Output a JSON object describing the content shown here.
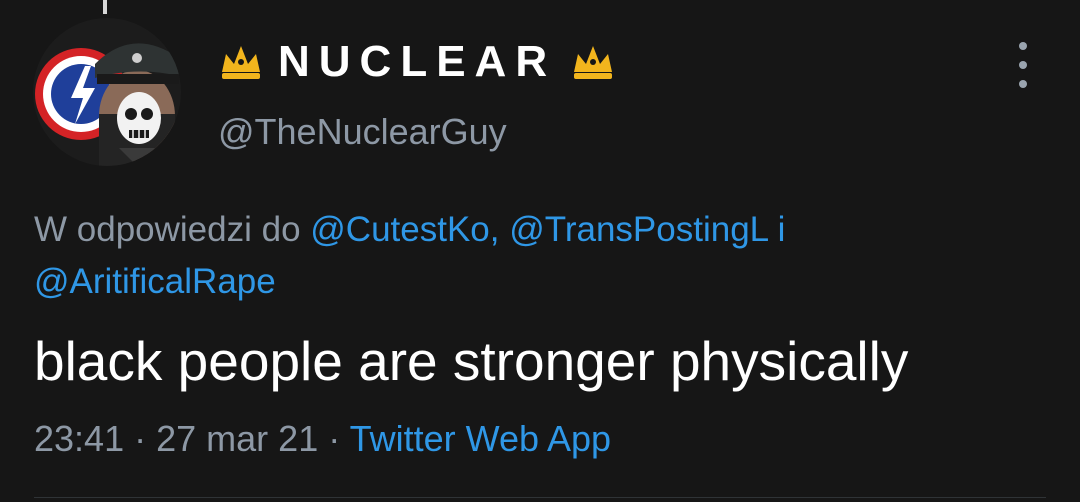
{
  "author": {
    "display_name": "NUCLEAR",
    "handle": "@TheNuclearGuy"
  },
  "reply": {
    "prefix": "W odpowiedzi do",
    "mention_1": "@CutestKo,",
    "mention_2": "@TransPostingL",
    "joiner": "i",
    "mention_3": "@AritificalRape"
  },
  "tweet": {
    "text": "black people are stronger physically",
    "time": "23:41",
    "separator": "·",
    "date": "27 mar 21",
    "source": "Twitter Web App"
  },
  "colors": {
    "background": "#161616",
    "accent": "#2f97e6",
    "muted": "#8d98a5",
    "crown": "#f2b51d"
  },
  "icons": {
    "left_emoji": "crown-icon",
    "right_emoji": "crown-icon",
    "menu": "more-vertical-icon"
  }
}
